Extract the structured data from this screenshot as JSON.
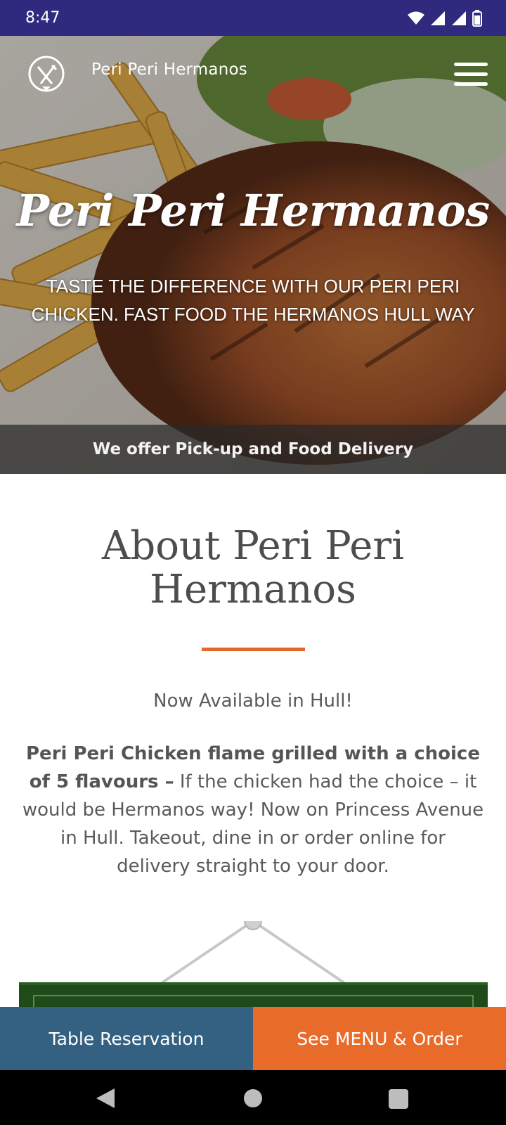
{
  "status_bar": {
    "time": "8:47",
    "icons": [
      "wifi-icon",
      "signal-icon",
      "signal-icon",
      "battery-icon"
    ]
  },
  "header": {
    "brand": "Peri Peri Hermanos",
    "logo_icon": "fork-knife-logo-icon",
    "menu_icon": "hamburger-menu-icon"
  },
  "hero": {
    "title": "Peri Peri Hermanos",
    "subtitle": "TASTE THE DIFFERENCE WITH OUR PERI PERI CHICKEN. FAST FOOD THE HERMANOS HULL WAY",
    "band_text": "We offer Pick-up and Food Delivery"
  },
  "about": {
    "title": "About Peri Peri Hermanos",
    "availability": "Now Available in Hull!",
    "body_bold": "Peri Peri Chicken flame grilled with a choice of 5 flavours –",
    "body_text": " If the chicken had the choice – it would be Hermanos way! Now on Princess Avenue in Hull. Takeout, dine in or order online for delivery straight to your door."
  },
  "actions": {
    "reserve_label": "Table Reservation",
    "menu_label": "See MENU & Order"
  },
  "colors": {
    "status_bar": "#2f2a7e",
    "accent": "#e2692b",
    "reserve_button": "#346181",
    "menu_button": "#e96b2a",
    "sign_board": "#1f4a1a"
  }
}
